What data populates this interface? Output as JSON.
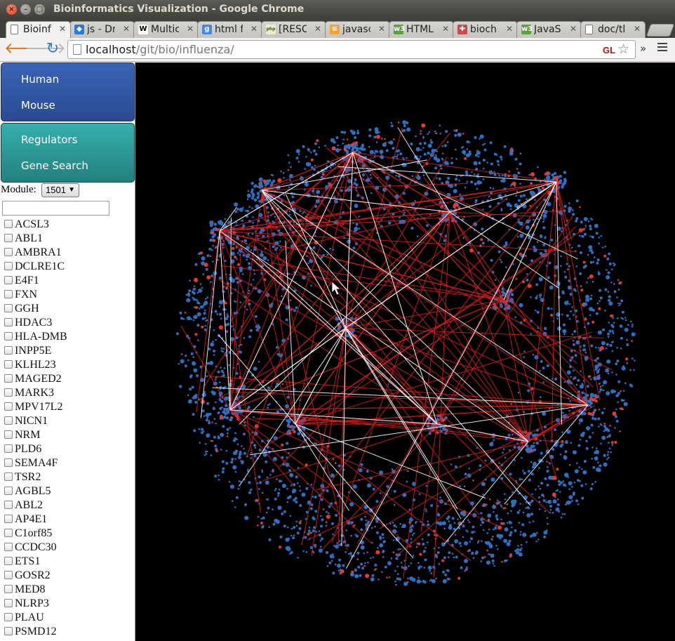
{
  "window": {
    "title": "Bioinformatics Visualization - Google Chrome"
  },
  "tabs": [
    {
      "label": "Bioinf",
      "icon": "page-icon",
      "active": true
    },
    {
      "label": "js - Dr",
      "icon": "dropbox-icon"
    },
    {
      "label": "Multic",
      "icon": "wikipedia-icon"
    },
    {
      "label": "html f",
      "icon": "google-icon"
    },
    {
      "label": "[RESC",
      "icon": "php-icon"
    },
    {
      "label": "javasc",
      "icon": "stackoverflow-icon"
    },
    {
      "label": "HTML",
      "icon": "w3schools-icon"
    },
    {
      "label": "bioch",
      "icon": "puzzle-icon"
    },
    {
      "label": "JavaS",
      "icon": "w3schools-icon"
    },
    {
      "label": "doc/tl",
      "icon": "page-icon"
    }
  ],
  "toolbar": {
    "url_host": "localhost",
    "url_path": "/git/bio/influenza/",
    "extension_label": "GL",
    "overflow_label": "»"
  },
  "sidebar": {
    "species": [
      {
        "label": "Human"
      },
      {
        "label": "Mouse"
      }
    ],
    "tools": [
      {
        "label": "Regulators"
      },
      {
        "label": "Gene Search"
      }
    ],
    "module_label": "Module:",
    "module_value": "1501",
    "search_value": "",
    "genes": [
      "ACSL3",
      "ABL1",
      "AMBRA1",
      "DCLRE1C",
      "E4F1",
      "FXN",
      "GGH",
      "HDAC3",
      "HLA-DMB",
      "INPP5E",
      "KLHL23",
      "MAGED2",
      "MARK3",
      "MPV17L2",
      "NICN1",
      "NRM",
      "PLD6",
      "SEMA4F",
      "TSR2",
      "AGBL5",
      "ABL2",
      "AP4E1",
      "C1orf85",
      "CCDC30",
      "ETS1",
      "GOSR2",
      "MED8",
      "NLRP3",
      "PLAU",
      "PSMD12"
    ]
  },
  "colors": {
    "node_blue": "#2f6fc2",
    "node_red": "#e8392e",
    "edge_red": "#d81c1c",
    "edge_white": "#ffffff",
    "background": "#000000"
  }
}
